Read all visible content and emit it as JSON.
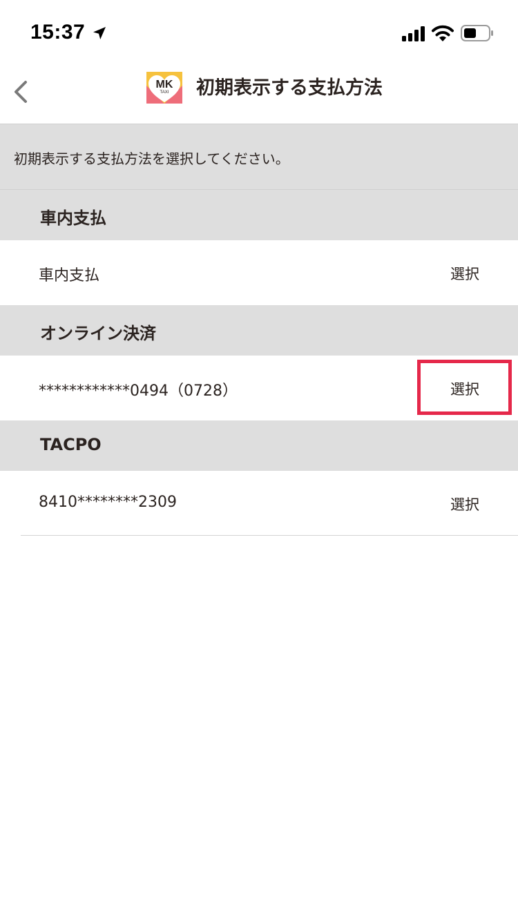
{
  "status_bar": {
    "time": "15:37",
    "icons": [
      "location-arrow-icon",
      "signal-icon",
      "wifi-icon",
      "battery-icon"
    ],
    "battery_level": 0.5
  },
  "nav": {
    "back_icon": "chevron-left-icon",
    "logo": {
      "letters": "MK",
      "sub": "TAXI"
    },
    "title": "初期表示する支払方法"
  },
  "description": "初期表示する支払方法を選択してください。",
  "sections": [
    {
      "header": "車内支払",
      "rows": [
        {
          "label": "車内支払",
          "action": "選択"
        }
      ]
    },
    {
      "header": "オンライン決済",
      "rows": [
        {
          "label": "************0494（0728）",
          "action": "選択",
          "highlighted": true
        }
      ]
    },
    {
      "header": "TACPO",
      "rows": [
        {
          "label": "8410********2309",
          "action": "選択"
        }
      ]
    }
  ],
  "colors": {
    "section_bg": "#dedede",
    "text": "#2b2320",
    "highlight": "#e5284a",
    "logo_yellow": "#f6c23e",
    "logo_pink": "#ee6d7a"
  }
}
